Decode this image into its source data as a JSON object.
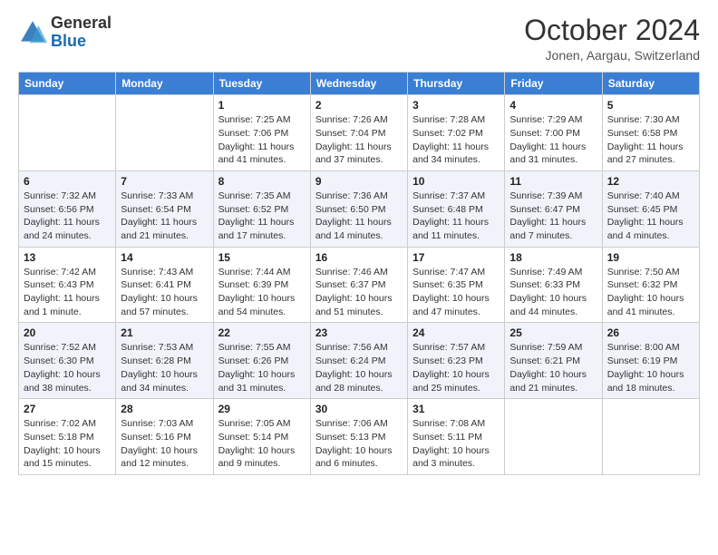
{
  "header": {
    "logo_general": "General",
    "logo_blue": "Blue",
    "month_title": "October 2024",
    "location": "Jonen, Aargau, Switzerland"
  },
  "weekdays": [
    "Sunday",
    "Monday",
    "Tuesday",
    "Wednesday",
    "Thursday",
    "Friday",
    "Saturday"
  ],
  "weeks": [
    [
      {
        "day": "",
        "sunrise": "",
        "sunset": "",
        "daylight": ""
      },
      {
        "day": "",
        "sunrise": "",
        "sunset": "",
        "daylight": ""
      },
      {
        "day": "1",
        "sunrise": "Sunrise: 7:25 AM",
        "sunset": "Sunset: 7:06 PM",
        "daylight": "Daylight: 11 hours and 41 minutes."
      },
      {
        "day": "2",
        "sunrise": "Sunrise: 7:26 AM",
        "sunset": "Sunset: 7:04 PM",
        "daylight": "Daylight: 11 hours and 37 minutes."
      },
      {
        "day": "3",
        "sunrise": "Sunrise: 7:28 AM",
        "sunset": "Sunset: 7:02 PM",
        "daylight": "Daylight: 11 hours and 34 minutes."
      },
      {
        "day": "4",
        "sunrise": "Sunrise: 7:29 AM",
        "sunset": "Sunset: 7:00 PM",
        "daylight": "Daylight: 11 hours and 31 minutes."
      },
      {
        "day": "5",
        "sunrise": "Sunrise: 7:30 AM",
        "sunset": "Sunset: 6:58 PM",
        "daylight": "Daylight: 11 hours and 27 minutes."
      }
    ],
    [
      {
        "day": "6",
        "sunrise": "Sunrise: 7:32 AM",
        "sunset": "Sunset: 6:56 PM",
        "daylight": "Daylight: 11 hours and 24 minutes."
      },
      {
        "day": "7",
        "sunrise": "Sunrise: 7:33 AM",
        "sunset": "Sunset: 6:54 PM",
        "daylight": "Daylight: 11 hours and 21 minutes."
      },
      {
        "day": "8",
        "sunrise": "Sunrise: 7:35 AM",
        "sunset": "Sunset: 6:52 PM",
        "daylight": "Daylight: 11 hours and 17 minutes."
      },
      {
        "day": "9",
        "sunrise": "Sunrise: 7:36 AM",
        "sunset": "Sunset: 6:50 PM",
        "daylight": "Daylight: 11 hours and 14 minutes."
      },
      {
        "day": "10",
        "sunrise": "Sunrise: 7:37 AM",
        "sunset": "Sunset: 6:48 PM",
        "daylight": "Daylight: 11 hours and 11 minutes."
      },
      {
        "day": "11",
        "sunrise": "Sunrise: 7:39 AM",
        "sunset": "Sunset: 6:47 PM",
        "daylight": "Daylight: 11 hours and 7 minutes."
      },
      {
        "day": "12",
        "sunrise": "Sunrise: 7:40 AM",
        "sunset": "Sunset: 6:45 PM",
        "daylight": "Daylight: 11 hours and 4 minutes."
      }
    ],
    [
      {
        "day": "13",
        "sunrise": "Sunrise: 7:42 AM",
        "sunset": "Sunset: 6:43 PM",
        "daylight": "Daylight: 11 hours and 1 minute."
      },
      {
        "day": "14",
        "sunrise": "Sunrise: 7:43 AM",
        "sunset": "Sunset: 6:41 PM",
        "daylight": "Daylight: 10 hours and 57 minutes."
      },
      {
        "day": "15",
        "sunrise": "Sunrise: 7:44 AM",
        "sunset": "Sunset: 6:39 PM",
        "daylight": "Daylight: 10 hours and 54 minutes."
      },
      {
        "day": "16",
        "sunrise": "Sunrise: 7:46 AM",
        "sunset": "Sunset: 6:37 PM",
        "daylight": "Daylight: 10 hours and 51 minutes."
      },
      {
        "day": "17",
        "sunrise": "Sunrise: 7:47 AM",
        "sunset": "Sunset: 6:35 PM",
        "daylight": "Daylight: 10 hours and 47 minutes."
      },
      {
        "day": "18",
        "sunrise": "Sunrise: 7:49 AM",
        "sunset": "Sunset: 6:33 PM",
        "daylight": "Daylight: 10 hours and 44 minutes."
      },
      {
        "day": "19",
        "sunrise": "Sunrise: 7:50 AM",
        "sunset": "Sunset: 6:32 PM",
        "daylight": "Daylight: 10 hours and 41 minutes."
      }
    ],
    [
      {
        "day": "20",
        "sunrise": "Sunrise: 7:52 AM",
        "sunset": "Sunset: 6:30 PM",
        "daylight": "Daylight: 10 hours and 38 minutes."
      },
      {
        "day": "21",
        "sunrise": "Sunrise: 7:53 AM",
        "sunset": "Sunset: 6:28 PM",
        "daylight": "Daylight: 10 hours and 34 minutes."
      },
      {
        "day": "22",
        "sunrise": "Sunrise: 7:55 AM",
        "sunset": "Sunset: 6:26 PM",
        "daylight": "Daylight: 10 hours and 31 minutes."
      },
      {
        "day": "23",
        "sunrise": "Sunrise: 7:56 AM",
        "sunset": "Sunset: 6:24 PM",
        "daylight": "Daylight: 10 hours and 28 minutes."
      },
      {
        "day": "24",
        "sunrise": "Sunrise: 7:57 AM",
        "sunset": "Sunset: 6:23 PM",
        "daylight": "Daylight: 10 hours and 25 minutes."
      },
      {
        "day": "25",
        "sunrise": "Sunrise: 7:59 AM",
        "sunset": "Sunset: 6:21 PM",
        "daylight": "Daylight: 10 hours and 21 minutes."
      },
      {
        "day": "26",
        "sunrise": "Sunrise: 8:00 AM",
        "sunset": "Sunset: 6:19 PM",
        "daylight": "Daylight: 10 hours and 18 minutes."
      }
    ],
    [
      {
        "day": "27",
        "sunrise": "Sunrise: 7:02 AM",
        "sunset": "Sunset: 5:18 PM",
        "daylight": "Daylight: 10 hours and 15 minutes."
      },
      {
        "day": "28",
        "sunrise": "Sunrise: 7:03 AM",
        "sunset": "Sunset: 5:16 PM",
        "daylight": "Daylight: 10 hours and 12 minutes."
      },
      {
        "day": "29",
        "sunrise": "Sunrise: 7:05 AM",
        "sunset": "Sunset: 5:14 PM",
        "daylight": "Daylight: 10 hours and 9 minutes."
      },
      {
        "day": "30",
        "sunrise": "Sunrise: 7:06 AM",
        "sunset": "Sunset: 5:13 PM",
        "daylight": "Daylight: 10 hours and 6 minutes."
      },
      {
        "day": "31",
        "sunrise": "Sunrise: 7:08 AM",
        "sunset": "Sunset: 5:11 PM",
        "daylight": "Daylight: 10 hours and 3 minutes."
      },
      {
        "day": "",
        "sunrise": "",
        "sunset": "",
        "daylight": ""
      },
      {
        "day": "",
        "sunrise": "",
        "sunset": "",
        "daylight": ""
      }
    ]
  ]
}
